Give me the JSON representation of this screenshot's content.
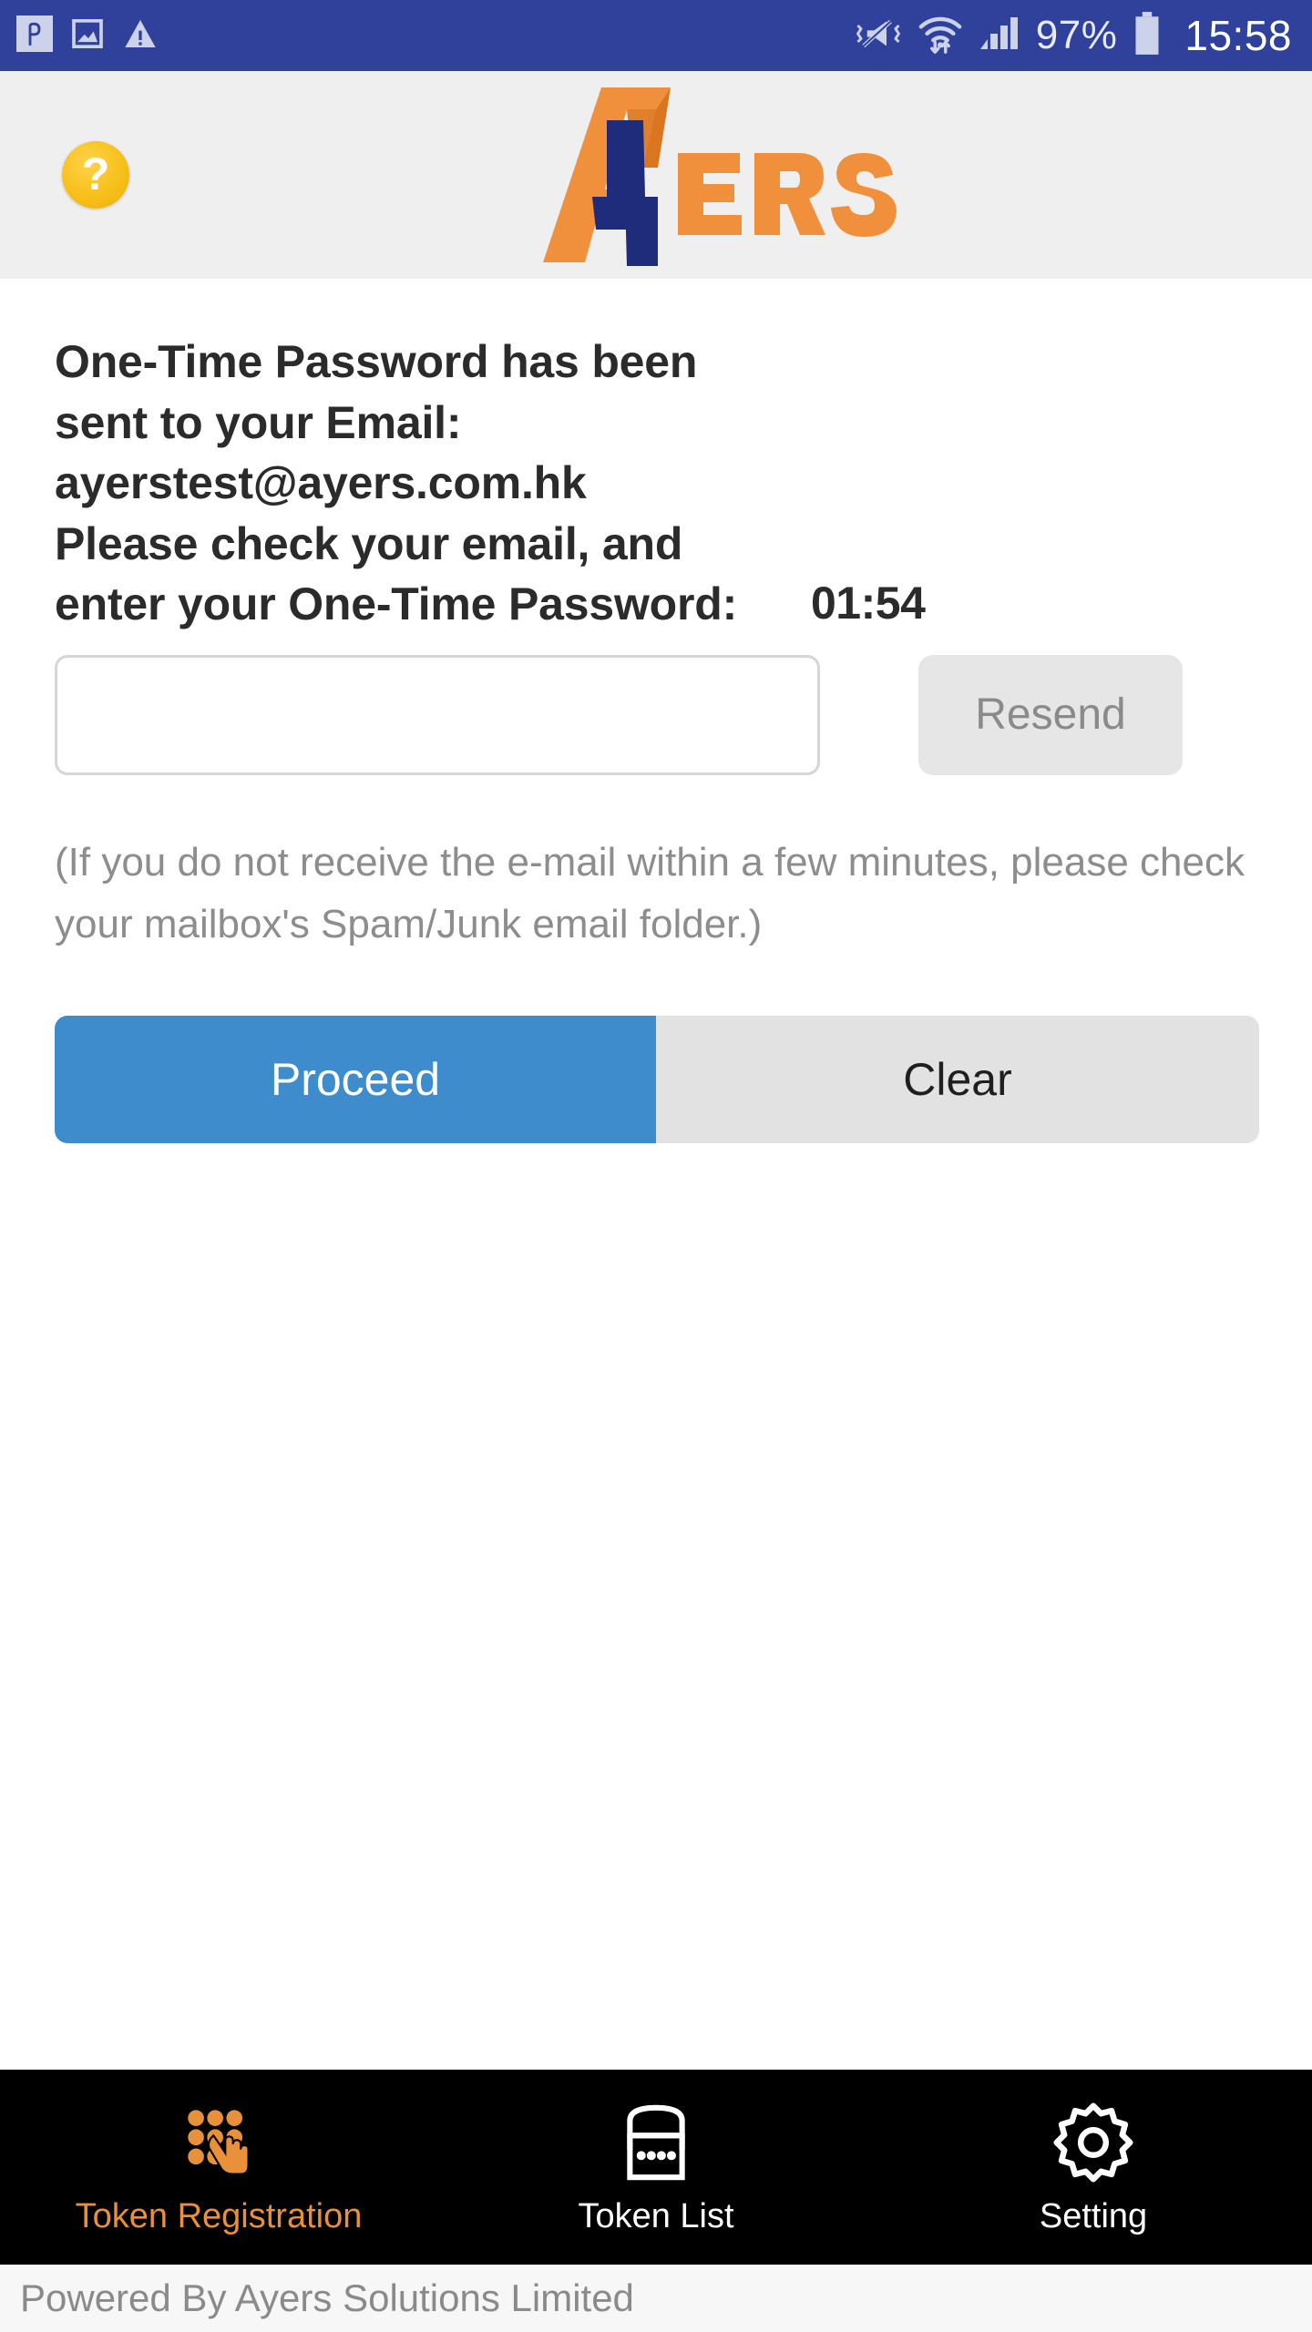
{
  "status_bar": {
    "background": "#2F419B",
    "left_icons": [
      "app-p-icon",
      "screenshot-image-icon",
      "warning-triangle-icon"
    ],
    "right_icons": [
      "vibrate-mute-icon",
      "wifi-icon",
      "cellular-signal-icon",
      "battery-icon"
    ],
    "battery_percent": "97%",
    "clock": "15:58"
  },
  "header": {
    "background": "#EFEFEF",
    "help_icon": "help-question-icon",
    "help_label": "?",
    "logo": {
      "name": "ayers-logo",
      "text_a": "A",
      "text_y": "Y",
      "text_ers": "ERS",
      "orange": "#F0903C",
      "navy": "#1F2B7B"
    }
  },
  "main": {
    "otp_message_lines": [
      "One-Time Password has been",
      "sent to your Email:",
      "ayerstest@ayers.com.hk",
      "Please check your email, and",
      "enter your One-Time Password:"
    ],
    "email": "ayerstest@ayers.com.hk",
    "timer": "01:54",
    "otp_input": {
      "value": "",
      "placeholder": ""
    },
    "resend_label": "Resend",
    "note": "(If you do not receive the e-mail within a few minutes, please check your mailbox's Spam/Junk email folder.)",
    "proceed_label": "Proceed",
    "clear_label": "Clear",
    "proceed_color": "#3E8CCC",
    "clear_color": "#E2E2E2"
  },
  "bottom_nav": {
    "active_color": "#E8903A",
    "items": [
      {
        "label": "Token Registration",
        "icon": "keypad-tap-icon",
        "active": true
      },
      {
        "label": "Token List",
        "icon": "token-lock-icon",
        "active": false
      },
      {
        "label": "Setting",
        "icon": "gear-icon",
        "active": false
      }
    ]
  },
  "footer": {
    "text": "Powered By Ayers Solutions Limited"
  }
}
